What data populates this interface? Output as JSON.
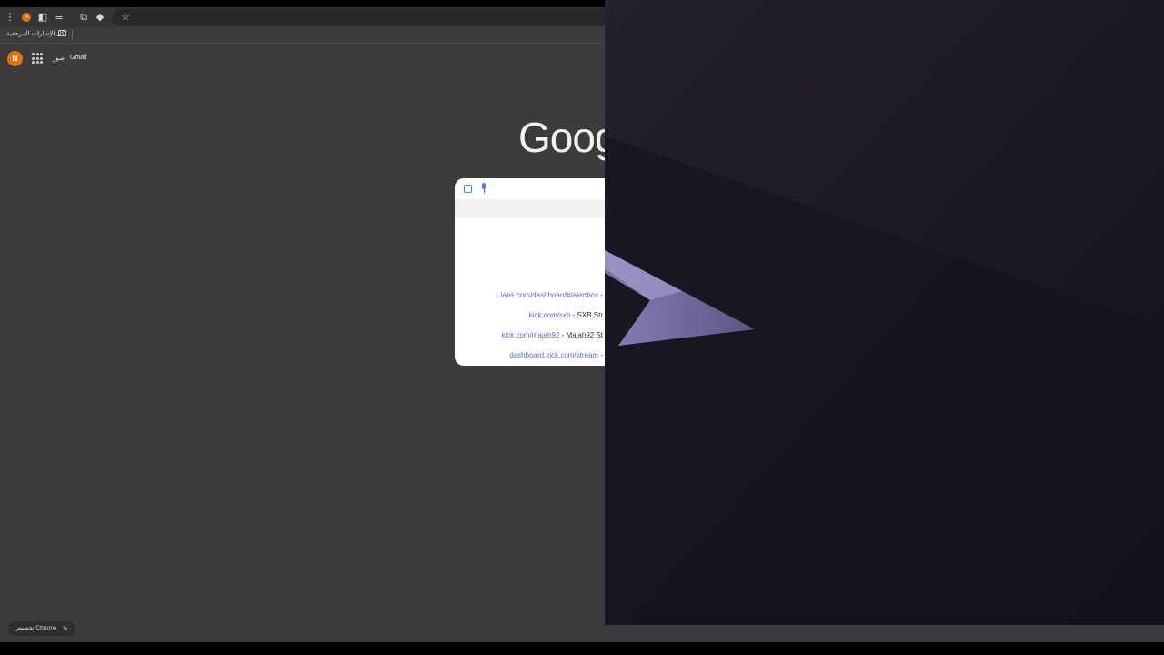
{
  "bookmarks": {
    "all_bookmarks_label": "كل الإشارات المرجعية"
  },
  "ntp": {
    "avatar_initial": "N",
    "images_link": "صور",
    "gmail_link": "Gmail",
    "logo_text": "Goog",
    "suggestions": [
      {
        "url": "...labs.com/dashboard#/alertbox",
        "title": " -"
      },
      {
        "url": "kick.com/sxb",
        "title": " - SXB Str"
      },
      {
        "url": "kick.com/majah92",
        "title": " - Majah92 St"
      },
      {
        "url": "dashboard.kick.com/stream",
        "title": " -"
      }
    ],
    "customize_label": "تخصيص Chrome"
  },
  "toolbar": {
    "profile_initial": "N"
  },
  "icons": [
    "menu-icon",
    "profile-icon",
    "side-panel-icon",
    "reading-list-icon",
    "extensions-icon",
    "extension-diamond-icon",
    "star-icon",
    "folder-icon",
    "apps-grid-icon",
    "google-lens-icon",
    "microphone-icon",
    "pencil-icon"
  ],
  "colors": {
    "chrome_bg": "#3c3c3c",
    "accent_orange": "#e8710a",
    "link_blue": "#5b6cc7",
    "wallpaper_bg": "#1a1823"
  }
}
